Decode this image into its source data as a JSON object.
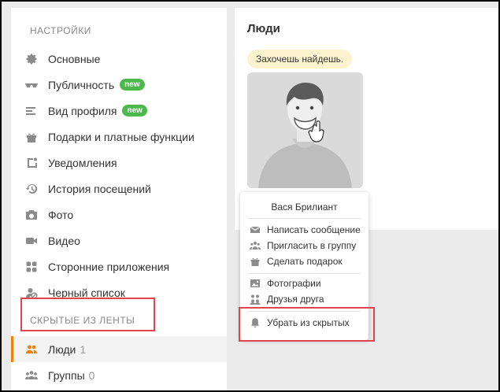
{
  "sidebar": {
    "heading": "НАСТРОЙКИ",
    "items": [
      {
        "icon": "gear-icon",
        "label": "Основные"
      },
      {
        "icon": "sunglasses-icon",
        "label": "Публичность",
        "badge": "new"
      },
      {
        "icon": "profile-lines-icon",
        "label": "Вид профиля",
        "badge": "new"
      },
      {
        "icon": "gift-icon",
        "label": "Подарки и платные функции"
      },
      {
        "icon": "notification-icon",
        "label": "Уведомления"
      },
      {
        "icon": "history-icon",
        "label": "История посещений"
      },
      {
        "icon": "camera-icon",
        "label": "Фото"
      },
      {
        "icon": "video-icon",
        "label": "Видео"
      },
      {
        "icon": "apps-icon",
        "label": "Сторонние приложения"
      },
      {
        "icon": "block-icon",
        "label": "Черный список"
      }
    ],
    "hidden_heading": "СКРЫТЫЕ ИЗ ЛЕНТЫ",
    "hidden_items": [
      {
        "icon": "people-icon",
        "label": "Люди",
        "count": "1"
      },
      {
        "icon": "groups-icon",
        "label": "Группы",
        "count": "0"
      }
    ]
  },
  "main": {
    "title": "Люди",
    "tooltip": "Захочешь найдешь.",
    "accent_color": "#ee8208"
  },
  "popup": {
    "name": "Вася Брилиант",
    "actions": [
      {
        "icon": "envelope-icon",
        "label": "Написать сообщение"
      },
      {
        "icon": "group-invite-icon",
        "label": "Пригласить в группу"
      },
      {
        "icon": "gift-icon",
        "label": "Сделать подарок"
      }
    ],
    "links": [
      {
        "icon": "photo-icon",
        "label": "Фотографии"
      },
      {
        "icon": "friends-icon",
        "label": "Друзья друга"
      }
    ],
    "unhide": {
      "icon": "bell-icon",
      "label": "Убрать из скрытых"
    }
  }
}
